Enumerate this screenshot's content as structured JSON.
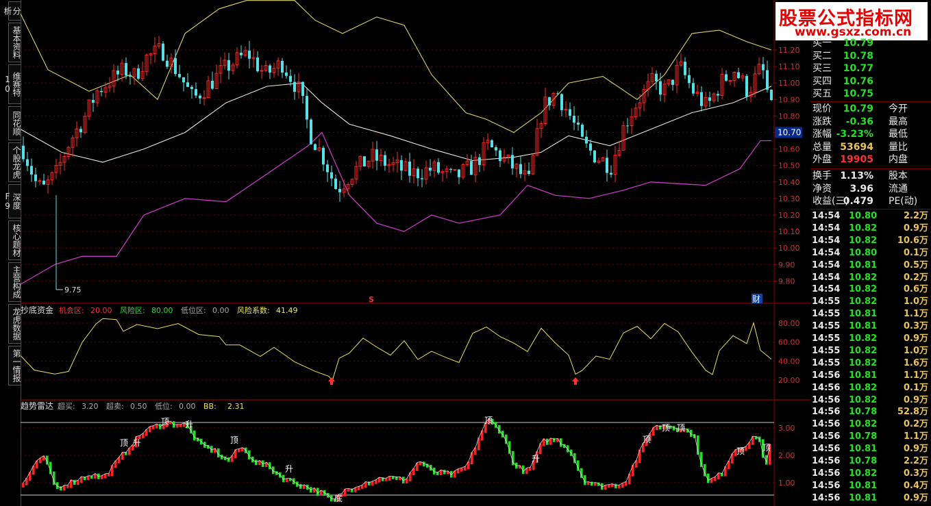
{
  "side_tabs": [
    "分析",
    "基本资料",
    "维赛特10",
    "同花顺",
    "个股龙虎",
    "深度F9",
    "核心题材",
    "主营构成",
    "龙虎数据",
    "第一情报"
  ],
  "logo": {
    "title": "股票公式指标网",
    "url": "www.gsxz.com.cn"
  },
  "price_axis": [
    "11.20",
    "11.10",
    "11.00",
    "10.90",
    "10.80",
    "10.70",
    "10.60",
    "10.50",
    "10.40",
    "10.30",
    "10.20",
    "10.10",
    "10.00",
    "9.90",
    "9.80"
  ],
  "current_price_tag": "10.70",
  "low_marker": "9.75",
  "main_markers": {
    "s_marker": "S",
    "cai_marker": "财"
  },
  "panel2": {
    "title": "抄底资金",
    "params": [
      {
        "label": "机会区:",
        "value": "20.00",
        "color": "#ff3030"
      },
      {
        "label": "风险区:",
        "value": "80.00",
        "color": "#33dd33"
      },
      {
        "label": "低位区:",
        "value": "0.00",
        "color": "#aaaaaa"
      },
      {
        "label": "风险系数:",
        "value": "41.49",
        "color": "#e8e85a"
      }
    ],
    "axis": [
      "80.00",
      "60.00",
      "40.00",
      "20.00"
    ]
  },
  "panel3": {
    "title": "趋势雷达",
    "params": [
      {
        "label": "超买:",
        "value": "3.20"
      },
      {
        "label": "超卖:",
        "value": "0.50"
      },
      {
        "label": "低位:",
        "value": "0.00"
      },
      {
        "label": "BB:",
        "value": "2.31"
      }
    ],
    "axis": [
      "3.00",
      "2.00",
      "1.00"
    ],
    "signal_labels": {
      "top": "顶",
      "rise": "升",
      "bottom": "底"
    }
  },
  "order_book": [
    {
      "label": "买一",
      "value": "10.79"
    },
    {
      "label": "买二",
      "value": "10.78"
    },
    {
      "label": "买三",
      "value": "10.77"
    },
    {
      "label": "买四",
      "value": "10.76"
    },
    {
      "label": "买五",
      "value": "10.75"
    }
  ],
  "quote": [
    {
      "l1": "现价",
      "v1": "10.79",
      "c1": "#23e023",
      "l2": "今开"
    },
    {
      "l1": "涨跌",
      "v1": "-0.36",
      "c1": "#23e023",
      "l2": "最高"
    },
    {
      "l1": "涨幅",
      "v1": "-3.23%",
      "c1": "#23e023",
      "l2": "最低"
    },
    {
      "l1": "总量",
      "v1": "53694",
      "c1": "#e8c35a",
      "l2": "量比"
    },
    {
      "l1": "外盘",
      "v1": "19905",
      "c1": "#ff3030",
      "l2": "内盘"
    }
  ],
  "stats": [
    {
      "l1": "换手",
      "v1": "1.13%",
      "l2": "股本"
    },
    {
      "l1": "净资",
      "v1": "3.96",
      "l2": "流通"
    },
    {
      "l1": "收益(三)",
      "v1": "0.479",
      "l2": "PE(动)"
    }
  ],
  "ticks": [
    {
      "time": "14:54",
      "price": "10.80",
      "vol": "2.2万"
    },
    {
      "time": "14:54",
      "price": "10.82",
      "vol": "0.9万"
    },
    {
      "time": "14:54",
      "price": "10.82",
      "vol": "10.6万"
    },
    {
      "time": "14:54",
      "price": "10.80",
      "vol": "0.1万"
    },
    {
      "time": "14:54",
      "price": "10.81",
      "vol": "0.5万"
    },
    {
      "time": "14:54",
      "price": "10.82",
      "vol": "0.2万"
    },
    {
      "time": "14:54",
      "price": "10.82",
      "vol": "0.6万"
    },
    {
      "time": "14:55",
      "price": "10.82",
      "vol": "1.0万"
    },
    {
      "time": "14:55",
      "price": "10.81",
      "vol": "1.1万"
    },
    {
      "time": "14:55",
      "price": "10.81",
      "vol": "0.3万"
    },
    {
      "time": "14:55",
      "price": "10.82",
      "vol": "0.9万"
    },
    {
      "time": "14:55",
      "price": "10.82",
      "vol": "1.0万"
    },
    {
      "time": "14:55",
      "price": "10.82",
      "vol": "1.6万"
    },
    {
      "time": "14:56",
      "price": "10.81",
      "vol": "1.1万"
    },
    {
      "time": "14:56",
      "price": "10.82",
      "vol": "0.1万"
    },
    {
      "time": "14:56",
      "price": "10.82",
      "vol": "0.9万"
    },
    {
      "time": "14:56",
      "price": "10.78",
      "vol": "52.8万"
    },
    {
      "time": "14:56",
      "price": "10.82",
      "vol": "0.2万"
    },
    {
      "time": "14:56",
      "price": "10.78",
      "vol": "1.1万"
    },
    {
      "time": "14:56",
      "price": "10.81",
      "vol": "0.9万"
    },
    {
      "time": "14:56",
      "price": "10.78",
      "vol": "2.2万"
    },
    {
      "time": "14:56",
      "price": "10.82",
      "vol": "0.3万"
    },
    {
      "time": "14:56",
      "price": "10.81",
      "vol": "0.4万"
    },
    {
      "time": "14:56",
      "price": "10.81",
      "vol": "0.9万"
    }
  ]
}
